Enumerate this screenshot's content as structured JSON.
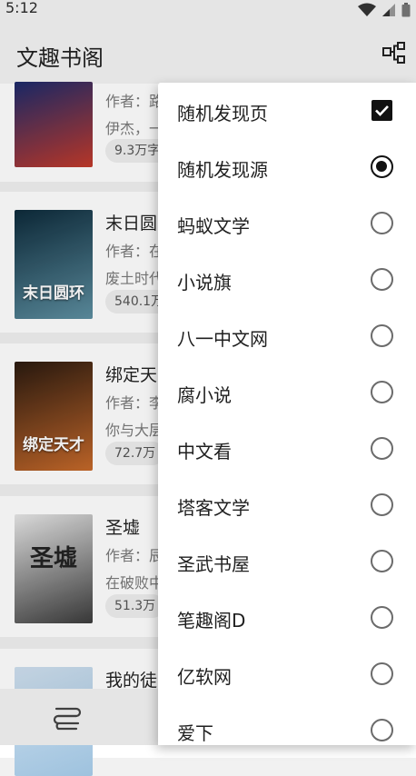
{
  "status_bar": {
    "time": "5:12"
  },
  "app_bar": {
    "title": "文趣书阁"
  },
  "books": [
    {
      "title": "",
      "author": "作者：路",
      "desc": "伊杰，一",
      "word_count": "9.3万字"
    },
    {
      "title": "末日圆",
      "author": "作者：在",
      "desc": "废土时代",
      "word_count": "540.1万"
    },
    {
      "title": "绑定天",
      "author": "作者：李",
      "desc": "你与大层",
      "word_count": "72.7万"
    },
    {
      "title": "圣墟",
      "author": "作者：辰",
      "desc": "在破败中",
      "word_count": "51.3万"
    },
    {
      "title": "我的徒",
      "author": "",
      "desc": "",
      "word_count": ""
    }
  ],
  "covers": [
    {
      "text": "",
      "colors": [
        "#1b2a6b",
        "#c23a2a"
      ]
    },
    {
      "text": "末日圆环",
      "colors": [
        "#0d2a3a",
        "#5d8fa1"
      ]
    },
    {
      "text": "绑定天才",
      "colors": [
        "#2a1a10",
        "#c6692a"
      ]
    },
    {
      "text": "圣墟",
      "colors": [
        "#e7e7e7",
        "#3b3b3b"
      ]
    },
    {
      "text": "",
      "colors": [
        "#cfe0ef",
        "#9ec2de"
      ]
    }
  ],
  "dropdown": {
    "items": [
      {
        "label": "随机发现页",
        "control": "checkbox",
        "checked": true
      },
      {
        "label": "随机发现源",
        "control": "radio",
        "checked": true
      },
      {
        "label": "蚂蚁文学",
        "control": "radio",
        "checked": false
      },
      {
        "label": "小说旗",
        "control": "radio",
        "checked": false
      },
      {
        "label": "八一中文网",
        "control": "radio",
        "checked": false
      },
      {
        "label": "腐小说",
        "control": "radio",
        "checked": false
      },
      {
        "label": "中文看",
        "control": "radio",
        "checked": false
      },
      {
        "label": "塔客文学",
        "control": "radio",
        "checked": false
      },
      {
        "label": "圣武书屋",
        "control": "radio",
        "checked": false
      },
      {
        "label": "笔趣阁D",
        "control": "radio",
        "checked": false
      },
      {
        "label": "亿软网",
        "control": "radio",
        "checked": false
      },
      {
        "label": "爱下",
        "control": "radio",
        "checked": false
      }
    ]
  },
  "icons": {
    "app_bar_menu": "source-switch-icon",
    "bottom_nav": "bookshelf-icon"
  }
}
